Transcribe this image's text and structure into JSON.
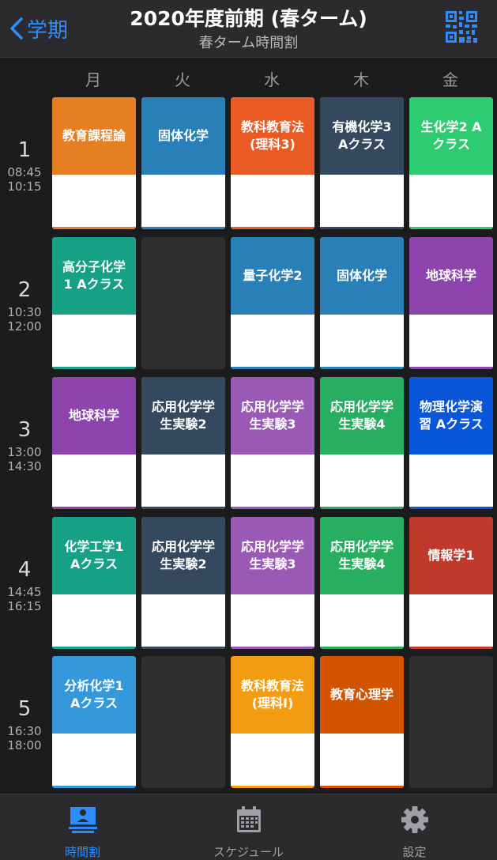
{
  "nav": {
    "back_label": "学期",
    "title": "2020年度前期 (春ターム)",
    "subtitle": "春ターム時間割"
  },
  "days": [
    "月",
    "火",
    "水",
    "木",
    "金"
  ],
  "periods": [
    {
      "num": "1",
      "start": "08:45",
      "end": "10:15"
    },
    {
      "num": "2",
      "start": "10:30",
      "end": "12:00"
    },
    {
      "num": "3",
      "start": "13:00",
      "end": "14:30"
    },
    {
      "num": "4",
      "start": "14:45",
      "end": "16:15"
    },
    {
      "num": "5",
      "start": "16:30",
      "end": "18:00"
    }
  ],
  "timetable": [
    [
      {
        "name": "教育課程論",
        "color": "#e67e22"
      },
      {
        "name": "固体化学",
        "color": "#2980b9"
      },
      {
        "name": "教科教育法\n(理科3)",
        "color": "#ea5a23"
      },
      {
        "name": "有機化学3\nAクラス",
        "color": "#34495e"
      },
      {
        "name": "生化学2 A\nクラス",
        "color": "#2ecc71"
      }
    ],
    [
      {
        "name": "高分子化学\n1 Aクラス",
        "color": "#16a085"
      },
      null,
      {
        "name": "量子化学2",
        "color": "#2980b9"
      },
      {
        "name": "固体化学",
        "color": "#2980b9"
      },
      {
        "name": "地球科学",
        "color": "#8e44ad"
      }
    ],
    [
      {
        "name": "地球科学",
        "color": "#8e44ad"
      },
      {
        "name": "応用化学学\n生実験2",
        "color": "#34495e"
      },
      {
        "name": "応用化学学\n生実験3",
        "color": "#9b59b6"
      },
      {
        "name": "応用化学学\n生実験4",
        "color": "#27ae60"
      },
      {
        "name": "物理化学演\n習 Aクラス",
        "color": "#0a56d8"
      }
    ],
    [
      {
        "name": "化学工学1\nAクラス",
        "color": "#16a085"
      },
      {
        "name": "応用化学学\n生実験2",
        "color": "#34495e"
      },
      {
        "name": "応用化学学\n生実験3",
        "color": "#9b59b6"
      },
      {
        "name": "応用化学学\n生実験4",
        "color": "#27ae60"
      },
      {
        "name": "情報学1",
        "color": "#c0392b"
      }
    ],
    [
      {
        "name": "分析化学1\nAクラス",
        "color": "#3498db"
      },
      null,
      {
        "name": "教科教育法\n(理科I)",
        "color": "#f39c12"
      },
      {
        "name": "教育心理学",
        "color": "#d35400"
      },
      null
    ]
  ],
  "tabs": [
    {
      "label": "時間割",
      "icon": "timetable-icon",
      "active": true
    },
    {
      "label": "スケジュール",
      "icon": "calendar-icon",
      "active": false
    },
    {
      "label": "設定",
      "icon": "gear-icon",
      "active": false
    }
  ],
  "colors": {
    "accent": "#2f8cff",
    "background": "#1c1c1e",
    "bar": "#2b2b2d"
  }
}
